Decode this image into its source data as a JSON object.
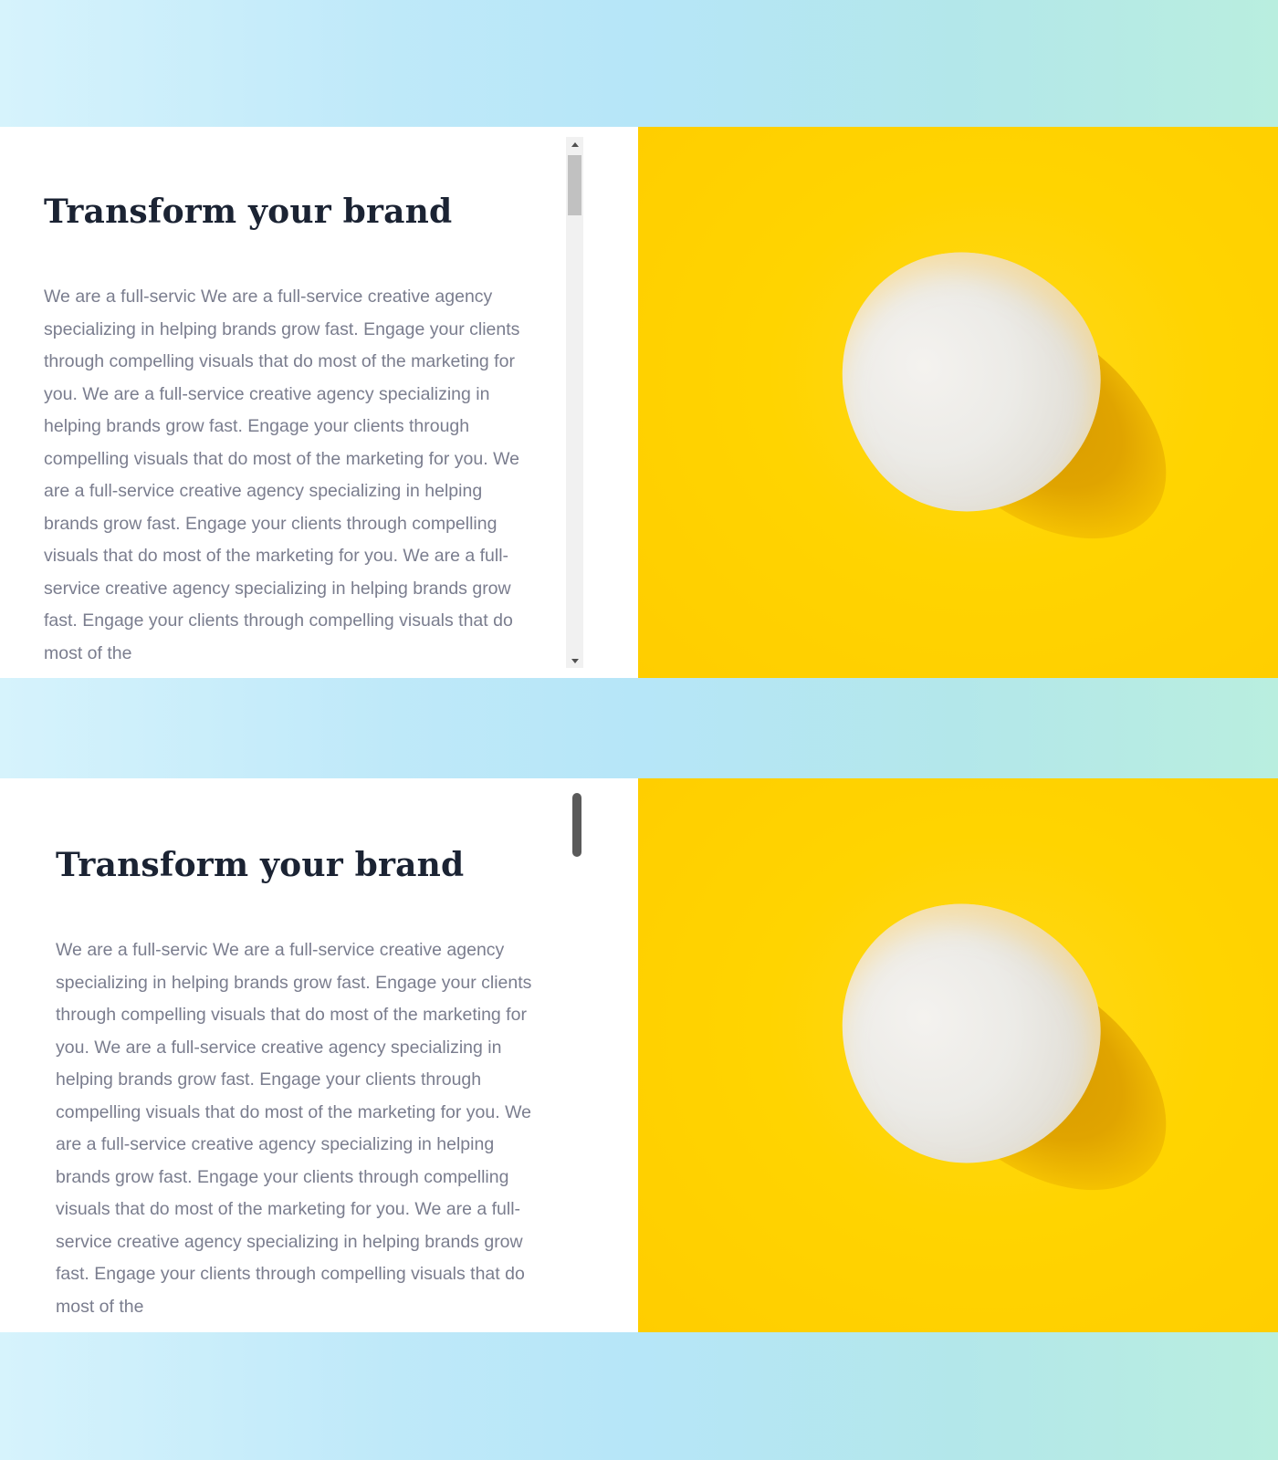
{
  "cards": [
    {
      "heading": "Transform your brand",
      "body": "We are a full-servic We are a full-service creative agency specializing in helping brands grow fast. Engage your clients through compelling visuals that do most of the marketing for you. We are a full-service creative agency specializing in helping brands grow fast. Engage your clients through compelling visuals that do most of the marketing for you. We are a full-service creative agency specializing in helping brands grow fast. Engage your clients through compelling visuals that do most of the marketing for you. We are a full-service creative agency specializing in helping brands grow fast. Engage your clients through compelling visuals that do most of the",
      "scrollbar_style": "classic",
      "image": "egg-on-yellow"
    },
    {
      "heading": "Transform your brand",
      "body": "We are a full-servic We are a full-service creative agency specializing in helping brands grow fast. Engage your clients through compelling visuals that do most of the marketing for you. We are a full-service creative agency specializing in helping brands grow fast. Engage your clients through compelling visuals that do most of the marketing for you. We are a full-service creative agency specializing in helping brands grow fast. Engage your clients through compelling visuals that do most of the marketing for you. We are a full-service creative agency specializing in helping brands grow fast. Engage your clients through compelling visuals that do most of the",
      "scrollbar_style": "overlay",
      "image": "egg-on-yellow"
    }
  ],
  "colors": {
    "heading": "#1b2333",
    "body_text": "#7a7d8e",
    "image_background": "#ffd400",
    "page_gradient_start": "#d6f3fc",
    "page_gradient_end": "#b9eedf"
  }
}
